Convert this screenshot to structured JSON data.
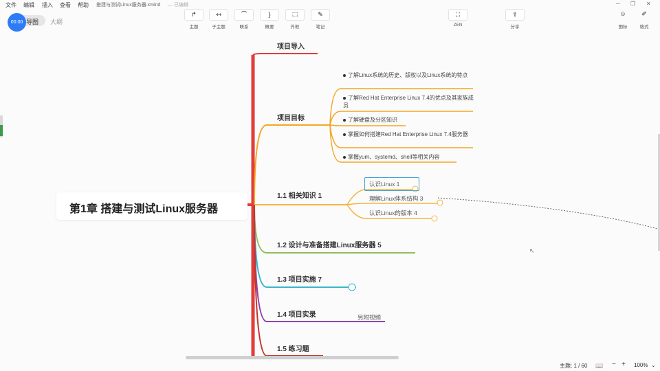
{
  "menu": [
    "文件",
    "编辑",
    "插入",
    "查看",
    "帮助"
  ],
  "document": {
    "title": "搭建与测试Linux服务器.xmind",
    "saved": "— 已编辑"
  },
  "timer": "00:00",
  "view_tabs": [
    "导图",
    "大纲"
  ],
  "toolbar": [
    {
      "icon": "topic-icon",
      "glyph": "↱",
      "label": "主题"
    },
    {
      "icon": "subtopic-icon",
      "glyph": "↤",
      "label": "子主题"
    },
    {
      "icon": "relationship-icon",
      "glyph": "⌒",
      "label": "联系"
    },
    {
      "icon": "summary-icon",
      "glyph": "}",
      "label": "概要"
    },
    {
      "icon": "boundary-icon",
      "glyph": "⬚",
      "label": "外框"
    },
    {
      "icon": "note-icon",
      "glyph": "✎",
      "label": "笔记"
    }
  ],
  "zen": {
    "glyph": "⛶",
    "label": "ZEN"
  },
  "share": {
    "glyph": "⇪",
    "label": "分享"
  },
  "right_tools": [
    {
      "glyph": "☺",
      "label": "图标"
    },
    {
      "glyph": "✐",
      "label": "格式"
    }
  ],
  "central_topic": "第1章  搭建与测试Linux服务器",
  "branches": [
    {
      "label": "项目导入"
    },
    {
      "label": "项目目标"
    },
    {
      "label": "1.1    相关知识    1"
    },
    {
      "label": "1.2    设计与准备搭建Linux服务器    5"
    },
    {
      "label": "1.3    项目实施    7"
    },
    {
      "label": "1.4    项目实录"
    },
    {
      "label": "1.5  练习题"
    }
  ],
  "goals": [
    "了解Linux系统的历史、版权以及Linux系统的特点",
    "了解Red Hat Enterprise Linux 7.4的优点及其家族成员",
    "了解硬盘及分区知识",
    "掌握如何搭建Red Hat Enterprise Linux 7.4服务器",
    "掌握yum、systemd、shell等相关内容"
  ],
  "knowledge_subs": [
    "认识Linux    1",
    "理解Linux体系结构    3",
    "认识Linux的版本    4"
  ],
  "video_note": "另附视频",
  "status": {
    "topics": "主题: 1 / 60",
    "zoom": "100%"
  }
}
